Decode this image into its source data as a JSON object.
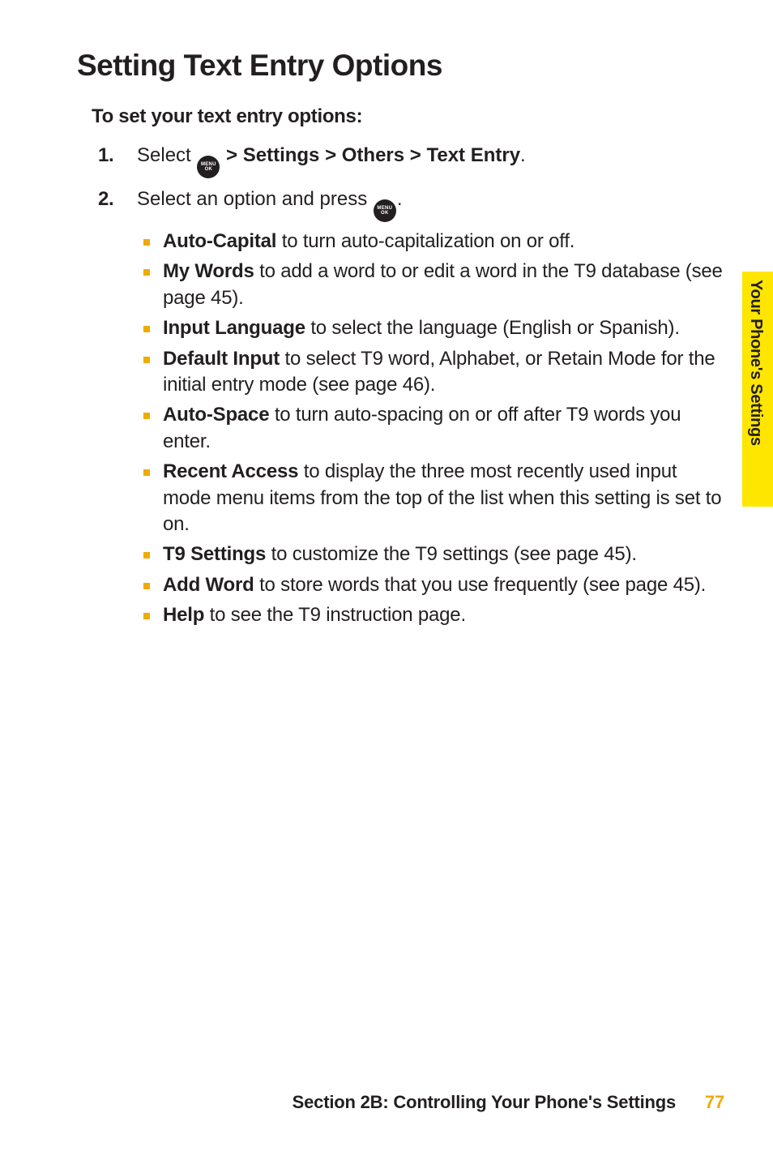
{
  "heading": "Setting Text Entry Options",
  "subheading": "To set your text entry options:",
  "icon_label": "MENU\nOK",
  "steps": [
    {
      "num": "1.",
      "prefix": "Select ",
      "after_icon_bold": " > Settings > Others > Text Entry",
      "suffix": "."
    },
    {
      "num": "2.",
      "prefix": "Select an option and press ",
      "after_icon_bold": "",
      "suffix": "."
    }
  ],
  "bullets": [
    {
      "bold": "Auto-Capital",
      "rest": " to turn auto-capitalization on or off."
    },
    {
      "bold": "My Words",
      "rest": " to add a word to or edit a word in the T9 database (see page 45)."
    },
    {
      "bold": "Input Language",
      "rest": " to select the language (English or Spanish)."
    },
    {
      "bold": "Default Input",
      "rest": " to select T9 word, Alphabet, or Retain Mode for the initial entry mode (see page 46)."
    },
    {
      "bold": "Auto-Space",
      "rest": " to turn auto-spacing on or off after T9 words you enter."
    },
    {
      "bold": "Recent Access",
      "rest": " to display the three most recently used input mode menu items from the top of the list when this setting is set to on."
    },
    {
      "bold": "T9 Settings",
      "rest": " to customize the T9 settings (see page 45)."
    },
    {
      "bold": "Add Word",
      "rest": " to store words that you use frequently (see page 45)."
    },
    {
      "bold": "Help",
      "rest": " to see the T9 instruction page."
    }
  ],
  "side_tab": "Your Phone's Settings",
  "footer_section": "Section 2B: Controlling Your Phone's Settings",
  "footer_page": "77"
}
